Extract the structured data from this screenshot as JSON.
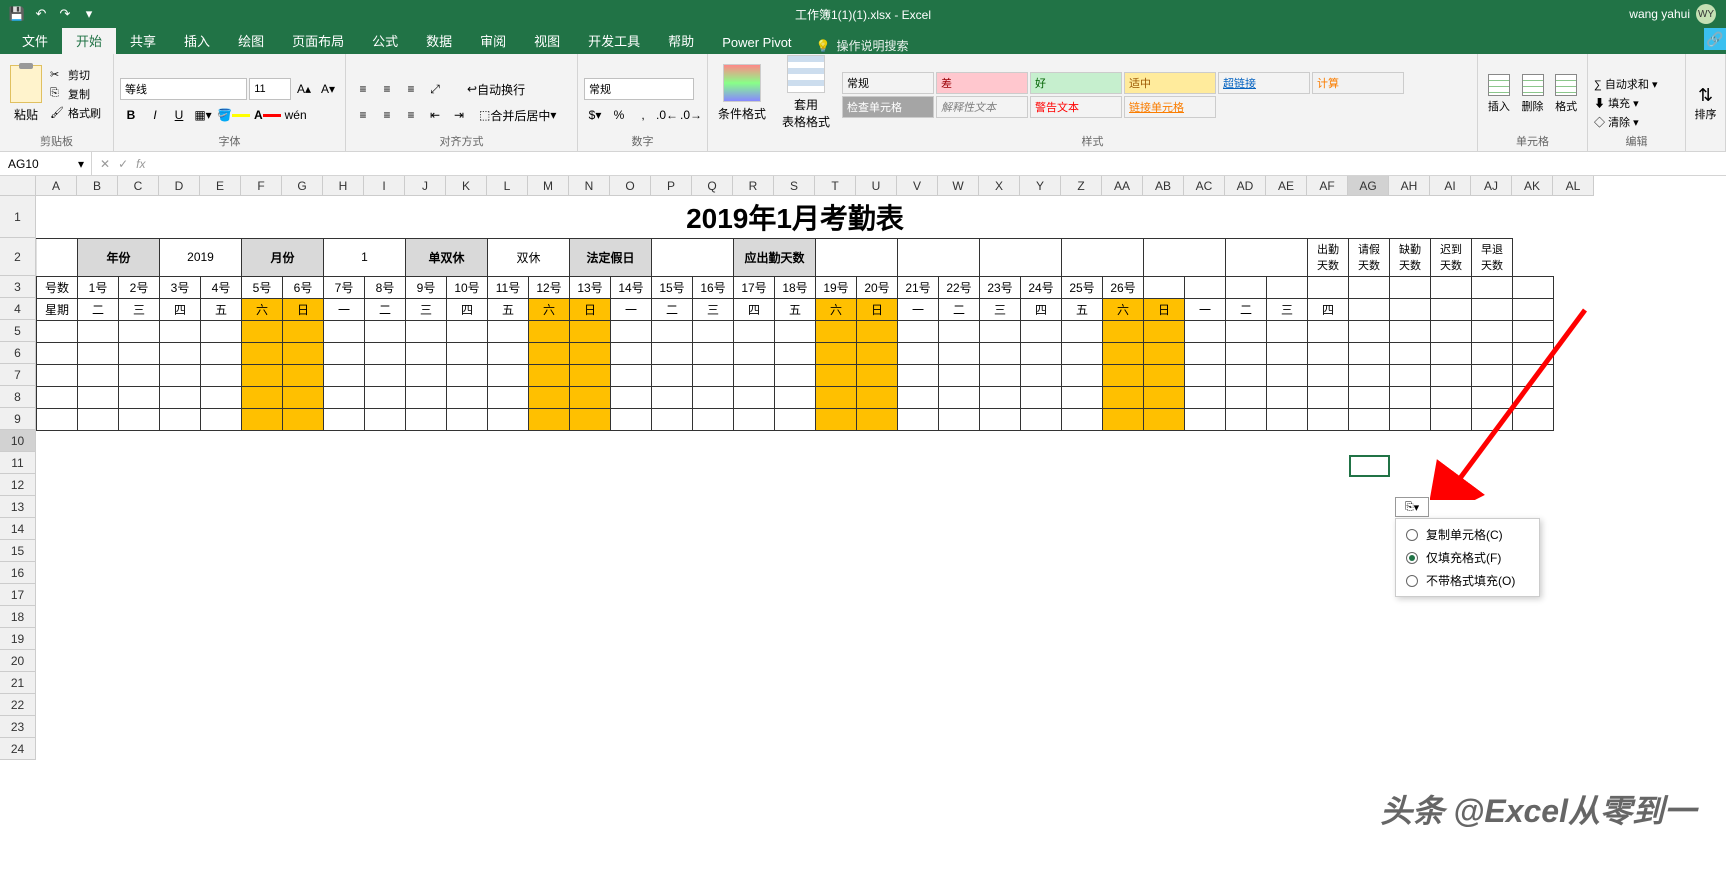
{
  "app": {
    "title": "工作簿1(1)(1).xlsx - Excel",
    "user": "wang yahui",
    "avatar": "WY"
  },
  "qat": {
    "save": "💾",
    "undo": "↶",
    "redo": "↷"
  },
  "tabs": {
    "file": "文件",
    "home": "开始",
    "share": "共享",
    "insert": "插入",
    "draw": "绘图",
    "layout": "页面布局",
    "formulas": "公式",
    "data": "数据",
    "review": "审阅",
    "view": "视图",
    "dev": "开发工具",
    "help": "帮助",
    "pivot": "Power Pivot",
    "tell": "操作说明搜索"
  },
  "ribbon": {
    "clipboard": {
      "paste": "粘贴",
      "cut": "剪切",
      "copy": "复制",
      "painter": "格式刷",
      "label": "剪贴板"
    },
    "font": {
      "name": "等线",
      "size": "11",
      "bold": "B",
      "italic": "I",
      "underline": "U",
      "label": "字体"
    },
    "align": {
      "wrap": "自动换行",
      "merge": "合并后居中",
      "label": "对齐方式"
    },
    "number": {
      "format": "常规",
      "label": "数字"
    },
    "styles": {
      "cond": "条件格式",
      "table": "套用\n表格格式",
      "s1": "常规",
      "s2": "差",
      "s3": "好",
      "s4": "适中",
      "s5": "超链接",
      "s6": "计算",
      "s7": "检查单元格",
      "s8": "解释性文本",
      "s9": "警告文本",
      "s10": "链接单元格",
      "label": "样式"
    },
    "cells": {
      "insert": "插入",
      "delete": "删除",
      "format": "格式",
      "label": "单元格"
    },
    "edit": {
      "sum": "自动求和",
      "fill": "填充",
      "clear": "清除",
      "label": "编辑"
    }
  },
  "fbar": {
    "name": "AG10",
    "fx": "fx"
  },
  "cols": [
    "A",
    "B",
    "C",
    "D",
    "E",
    "F",
    "G",
    "H",
    "I",
    "J",
    "K",
    "L",
    "M",
    "N",
    "O",
    "P",
    "Q",
    "R",
    "S",
    "T",
    "U",
    "V",
    "W",
    "X",
    "Y",
    "Z",
    "AA",
    "AB",
    "AC",
    "AD",
    "AE",
    "AF",
    "AG",
    "AH",
    "AI",
    "AJ",
    "AK",
    "AL"
  ],
  "rows": [
    "1",
    "2",
    "3",
    "4",
    "5",
    "6",
    "7",
    "8",
    "9",
    "10",
    "11",
    "12",
    "13",
    "14",
    "15",
    "16",
    "17",
    "18",
    "19",
    "20",
    "21",
    "22",
    "23",
    "24"
  ],
  "sheet": {
    "title": "2019年1月考勤表",
    "hdr2": {
      "year_l": "年份",
      "year_v": "2019",
      "month_l": "月份",
      "month_v": "1",
      "rest_l": "单双休",
      "rest_v": "双休",
      "holiday_l": "法定假日",
      "attend_l": "应出勤天数"
    },
    "hdr_side": [
      "出勤\n天数",
      "请假\n天数",
      "缺勤\n天数",
      "迟到\n天数",
      "早退\n天数"
    ],
    "row3_label": "号数",
    "row3": [
      "1号",
      "2号",
      "3号",
      "4号",
      "5号",
      "6号",
      "7号",
      "8号",
      "9号",
      "10号",
      "11号",
      "12号",
      "13号",
      "14号",
      "15号",
      "16号",
      "17号",
      "18号",
      "19号",
      "20号",
      "21号",
      "22号",
      "23号",
      "24号",
      "25号",
      "26号"
    ],
    "row4_label": "星期",
    "row4": [
      "二",
      "三",
      "四",
      "五",
      "六",
      "日",
      "一",
      "二",
      "三",
      "四",
      "五",
      "六",
      "日",
      "一",
      "二",
      "三",
      "四",
      "五",
      "六",
      "日",
      "一",
      "二",
      "三",
      "四",
      "五",
      "六",
      "日",
      "一",
      "二",
      "三",
      "四"
    ],
    "weekends": [
      4,
      5,
      11,
      12,
      18,
      19,
      25,
      26
    ]
  },
  "autofill": {
    "btn": "⎘",
    "o1": "复制单元格(C)",
    "o2": "仅填充格式(F)",
    "o3": "不带格式填充(O)"
  },
  "watermark": "头条 @Excel从零到一"
}
